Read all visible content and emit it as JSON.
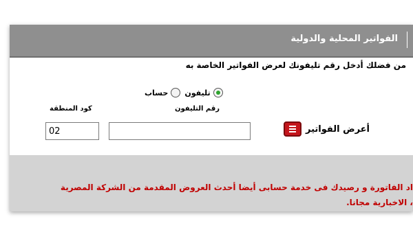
{
  "title": "الفواتير المحلية والدولية",
  "instruction": "من فضلك أدخل رقم تليفونك لعرض الفواتير الخاصة به",
  "account_type": {
    "options": [
      "تليفون",
      "حساب"
    ],
    "selected": "تليفون"
  },
  "fields": {
    "area_code_label": "كود المنطقة",
    "area_code_value": "02",
    "phone_label": "رقم التليفون",
    "phone_value": ""
  },
  "view_button": {
    "label": "أعرض الفواتير",
    "icon": "list-icon"
  },
  "footer": {
    "line1": "اد الفاتورة و رصيدك فى خدمة حسابى أيضا أحدث العروض المقدمة من الشركة المصرية",
    "line2": "، الاخبارية مجانا."
  },
  "colors": {
    "title_bar": "#8f8f8f",
    "button": "#c4161c",
    "promo_text": "#c00000",
    "footer_bg": "#d3d3d3"
  }
}
